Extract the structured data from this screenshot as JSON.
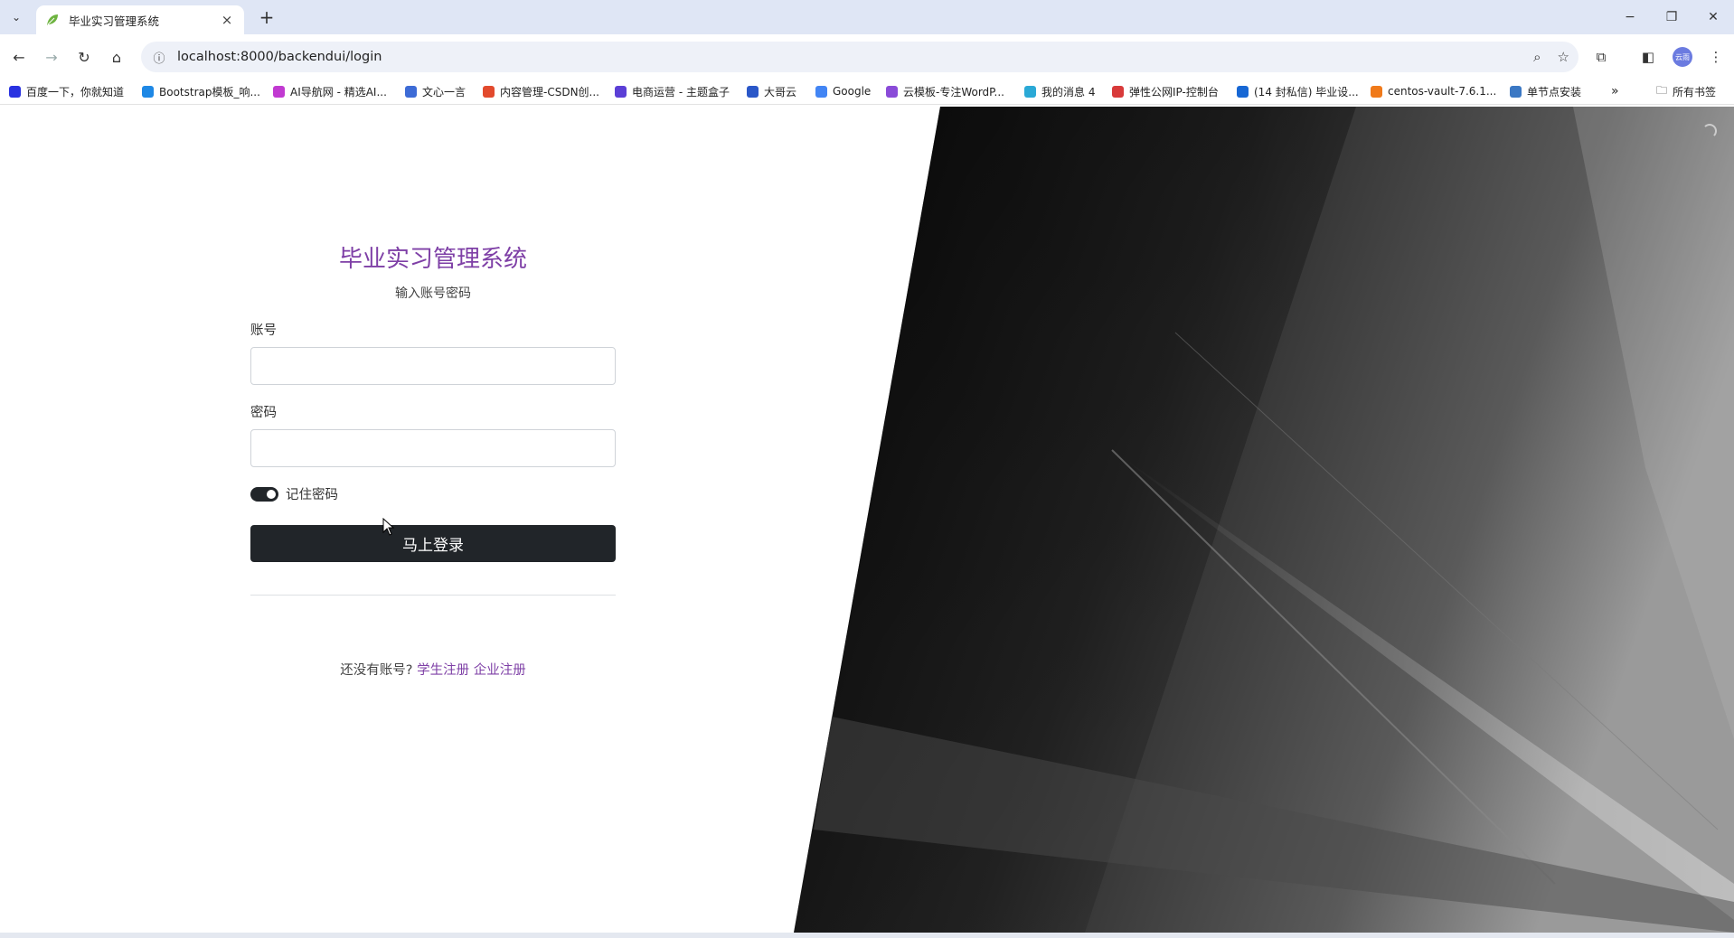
{
  "browser": {
    "tab": {
      "title": "毕业实习管理系统",
      "close": "×"
    },
    "new_tab": "+",
    "window_controls": {
      "minimize": "−",
      "restore": "❐",
      "close": "✕"
    },
    "url": "localhost:8000/backendui/login"
  },
  "bookmarks": [
    {
      "label": "百度一下，你就知道",
      "color": "#2932e1"
    },
    {
      "label": "Bootstrap模板_响...",
      "color": "#1e88e5"
    },
    {
      "label": "AI导航网 - 精选AI...",
      "color": "#c13ad1"
    },
    {
      "label": "文心一言",
      "color": "#3d6bd6"
    },
    {
      "label": "内容管理-CSDN创...",
      "color": "#e24a2d"
    },
    {
      "label": "电商运营 - 主题盒子",
      "color": "#5b3fd6"
    },
    {
      "label": "大哥云",
      "color": "#2a57c8"
    },
    {
      "label": "Google",
      "color": "#4285f4"
    },
    {
      "label": "云模板-专注WordP...",
      "color": "#8a4bd8"
    },
    {
      "label": "我的消息 4",
      "color": "#2aa9d6"
    },
    {
      "label": "弹性公网IP-控制台",
      "color": "#d83a3a"
    },
    {
      "label": "(14 封私信) 毕业设...",
      "color": "#1767d4"
    },
    {
      "label": "centos-vault-7.6.1...",
      "color": "#f07a1a"
    },
    {
      "label": "单节点安装",
      "color": "#3b78c4"
    }
  ],
  "bookmarks_more": "»",
  "all_bookmarks": "所有书签",
  "profile_label": "云雨",
  "login": {
    "title": "毕业实习管理系统",
    "subtitle": "输入账号密码",
    "account_label": "账号",
    "account_value": "",
    "password_label": "密码",
    "password_value": "",
    "remember_label": "记住密码",
    "remember_checked": true,
    "submit_label": "马上登录",
    "register_prompt": "还没有账号?",
    "student_register": "学生注册",
    "company_register": "企业注册"
  },
  "colors": {
    "accent": "#7e3fa6",
    "button": "#212529",
    "chrome_bg": "#dfe6f5"
  }
}
